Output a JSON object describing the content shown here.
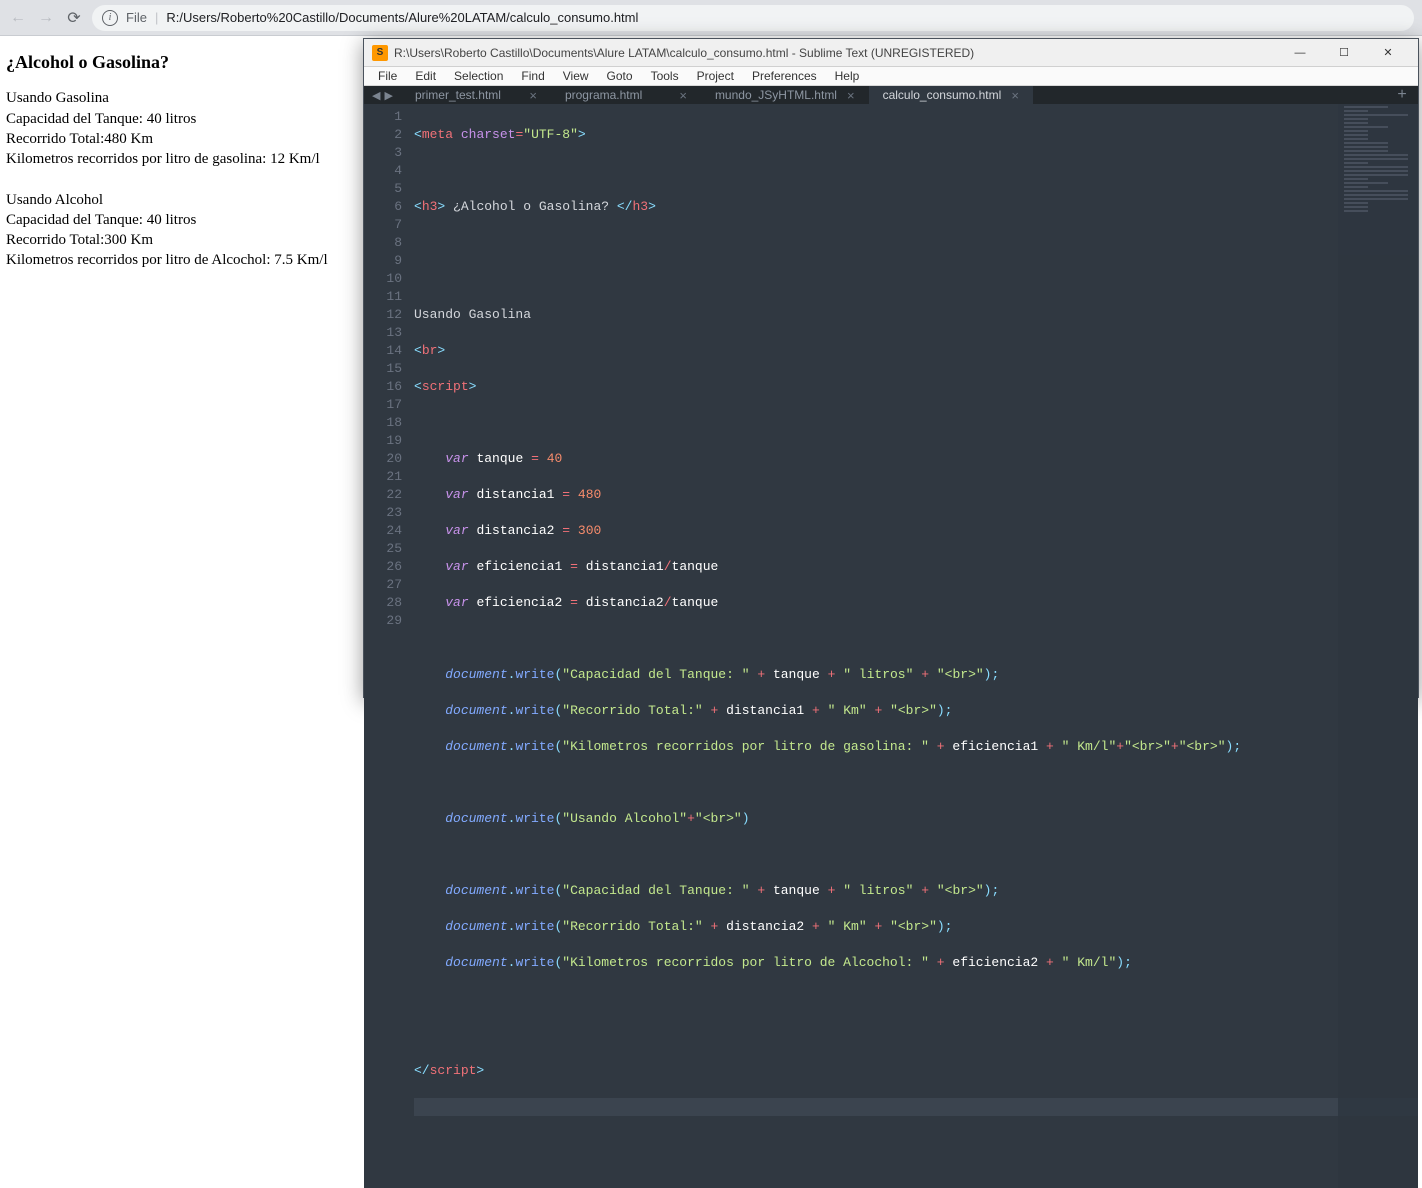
{
  "browser": {
    "url_protocol": "File",
    "url_path": "R:/Users/Roberto%20Castillo/Documents/Alure%20LATAM/calculo_consumo.html"
  },
  "page": {
    "title": "¿Alcohol o Gasolina?",
    "section1_header": "Usando Gasolina",
    "line_tank1": "Capacidad del Tanque: 40 litros",
    "line_dist1": "Recorrido Total:480 Km",
    "line_eff1": "Kilometros recorridos por litro de gasolina: 12 Km/l",
    "section2_header": "Usando Alcohol",
    "line_tank2": "Capacidad del Tanque: 40 litros",
    "line_dist2": "Recorrido Total:300 Km",
    "line_eff2": "Kilometros recorridos por litro de Alcochol: 7.5 Km/l"
  },
  "sublime": {
    "title": "R:\\Users\\Roberto Castillo\\Documents\\Alure LATAM\\calculo_consumo.html - Sublime Text (UNREGISTERED)",
    "menu": [
      "File",
      "Edit",
      "Selection",
      "Find",
      "View",
      "Goto",
      "Tools",
      "Project",
      "Preferences",
      "Help"
    ],
    "tabs": [
      {
        "label": "primer_test.html",
        "active": false
      },
      {
        "label": "programa.html",
        "active": false
      },
      {
        "label": "mundo_JSyHTML.html",
        "active": false
      },
      {
        "label": "calculo_consumo.html",
        "active": true
      }
    ],
    "code": {
      "l1_attr": "meta",
      "l1_attr2": "charset",
      "l1_val": "\"UTF-8\"",
      "l3_tag": "h3",
      "l3_txt": " ¿Alcohol o Gasolina? ",
      "l6_txt": "Usando Gasolina",
      "l7_tag": "br",
      "l8_tag": "script",
      "l10_kw": "var",
      "l10_v": "tanque",
      "l10_n": "40",
      "l11_kw": "var",
      "l11_v": "distancia1",
      "l11_n": "480",
      "l12_kw": "var",
      "l12_v": "distancia2",
      "l12_n": "300",
      "l13_kw": "var",
      "l13_v": "eficiencia1",
      "l13_e1": "distancia1",
      "l13_e2": "tanque",
      "l14_kw": "var",
      "l14_v": "eficiencia2",
      "l14_e1": "distancia2",
      "l14_e2": "tanque",
      "l16_obj": "document",
      "l16_fn": "write",
      "l16_s1": "\"Capacidad del Tanque: \"",
      "l16_v": "tanque",
      "l16_s2": "\" litros\"",
      "l16_s3": "\"<br>\"",
      "l17_obj": "document",
      "l17_fn": "write",
      "l17_s1": "\"Recorrido Total:\"",
      "l17_v": "distancia1",
      "l17_s2": "\" Km\"",
      "l17_s3": "\"<br>\"",
      "l18_obj": "document",
      "l18_fn": "write",
      "l18_s1": "\"Kilometros recorridos por litro de gasolina: \"",
      "l18_v": "eficiencia1",
      "l18_s2": "\" Km/l\"",
      "l18_s3": "\"<br>\"",
      "l18_s4": "\"<br>\"",
      "l20_obj": "document",
      "l20_fn": "write",
      "l20_s1": "\"Usando Alcohol\"",
      "l20_s2": "\"<br>\"",
      "l22_obj": "document",
      "l22_fn": "write",
      "l22_s1": "\"Capacidad del Tanque: \"",
      "l22_v": "tanque",
      "l22_s2": "\" litros\"",
      "l22_s3": "\"<br>\"",
      "l23_obj": "document",
      "l23_fn": "write",
      "l23_s1": "\"Recorrido Total:\"",
      "l23_v": "distancia2",
      "l23_s2": "\" Km\"",
      "l23_s3": "\"<br>\"",
      "l24_obj": "document",
      "l24_fn": "write",
      "l24_s1": "\"Kilometros recorridos por litro de Alcochol: \"",
      "l24_v": "eficiencia2",
      "l24_s2": "\" Km/l\"",
      "l27_tag": "script"
    }
  }
}
